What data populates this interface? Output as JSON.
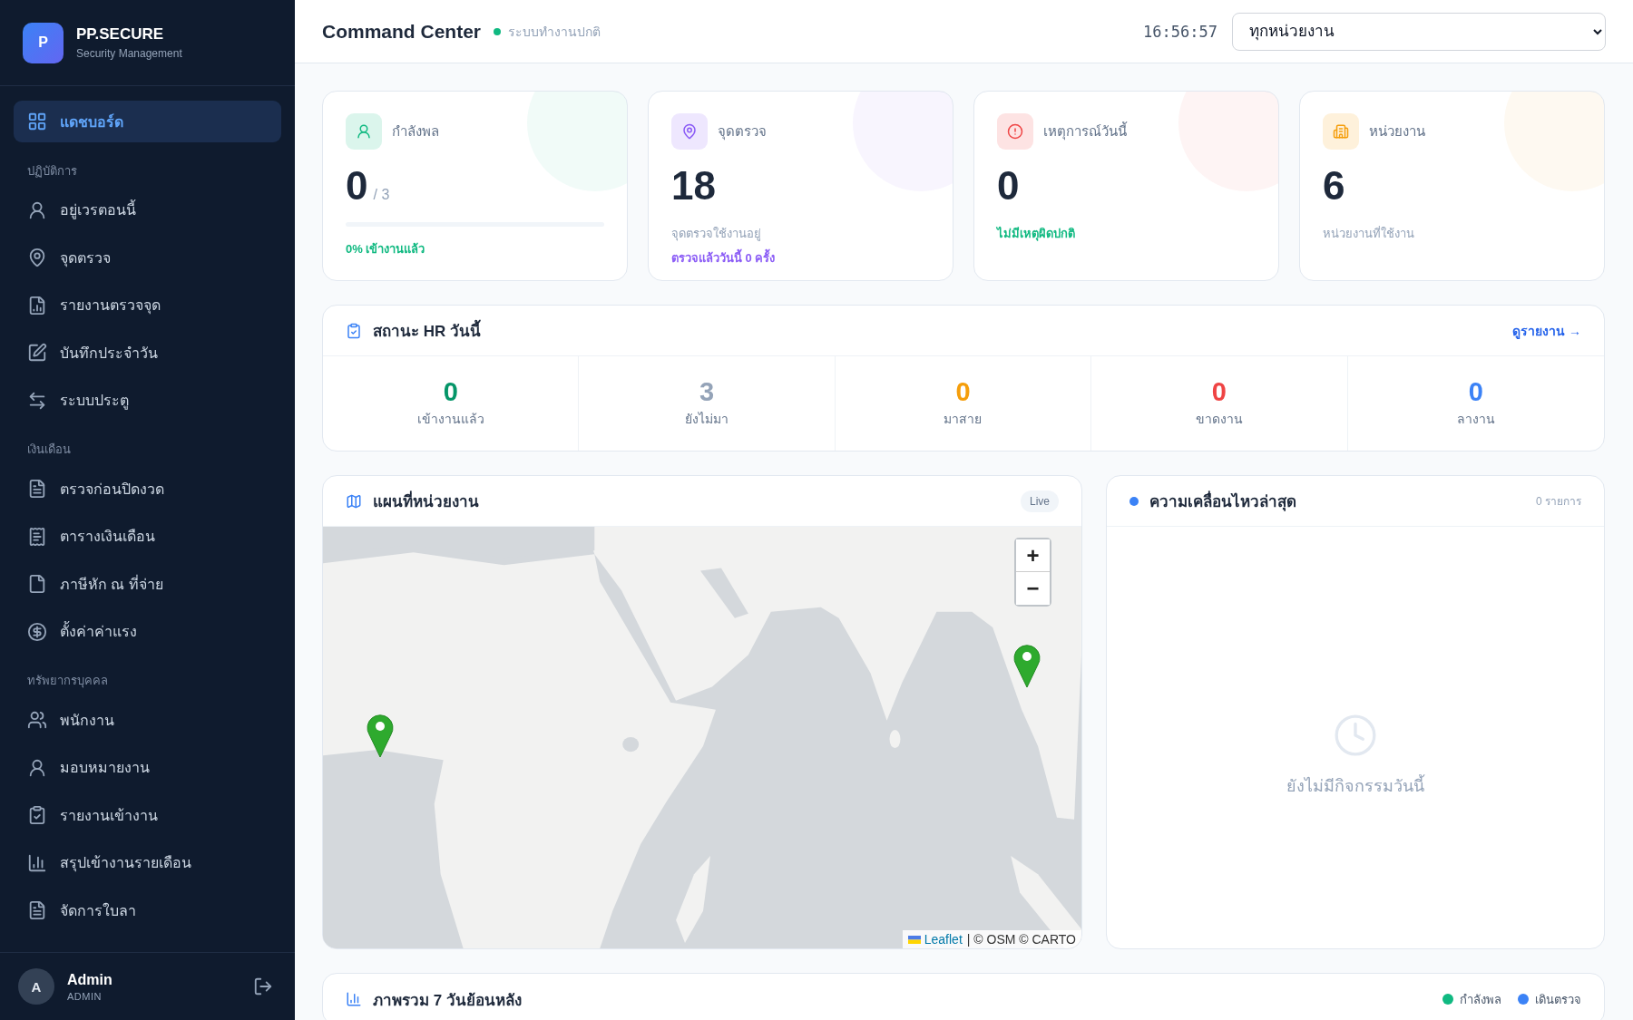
{
  "brand": {
    "logo_letter": "P",
    "name": "PP.SECURE",
    "tagline": "Security Management"
  },
  "sidebar": {
    "items": [
      {
        "label": "แดชบอร์ด",
        "selected": true
      }
    ],
    "sections": [
      {
        "title": "ปฏิบัติการ",
        "items": [
          {
            "label": "อยู่เวรตอนนี้",
            "selected": false
          },
          {
            "label": "จุดตรวจ",
            "selected": false
          },
          {
            "label": "รายงานตรวจจุด",
            "selected": false
          },
          {
            "label": "บันทึกประจำวัน",
            "selected": false
          },
          {
            "label": "ระบบประตู",
            "selected": false
          }
        ]
      },
      {
        "title": "เงินเดือน",
        "items": [
          {
            "label": "ตรวจก่อนปิดงวด",
            "selected": false
          },
          {
            "label": "ตารางเงินเดือน",
            "selected": false
          },
          {
            "label": "ภาษีหัก ณ ที่จ่าย",
            "selected": false
          },
          {
            "label": "ตั้งค่าค่าแรง",
            "selected": false
          }
        ]
      },
      {
        "title": "ทรัพยากรบุคคล",
        "items": [
          {
            "label": "พนักงาน",
            "selected": false
          },
          {
            "label": "มอบหมายงาน",
            "selected": false
          },
          {
            "label": "รายงานเข้างาน",
            "selected": false
          },
          {
            "label": "สรุปเข้างานรายเดือน",
            "selected": false
          },
          {
            "label": "จัดการใบลา",
            "selected": false
          }
        ]
      }
    ],
    "user": {
      "initial": "A",
      "name": "Admin",
      "role": "ADMIN"
    }
  },
  "header": {
    "title": "Command Center",
    "status": "ระบบทำงานปกติ",
    "clock": "16:56:57",
    "unit_select": "ทุกหน่วยงาน"
  },
  "stat_cards": [
    {
      "label": "กำลังพล",
      "value": "0",
      "total": "/ 3",
      "color": "#10b981",
      "level": 0,
      "notes": [
        {
          "text": "0% เข้างานแล้ว",
          "kind": "accent"
        }
      ]
    },
    {
      "label": "จุดตรวจ",
      "value": "18",
      "color": "#8b5cf6",
      "notes": [
        {
          "text": "จุดตรวจใช้งานอยู่",
          "kind": "muted"
        },
        {
          "text": "ตรวจแล้ววันนี้ 0 ครั้ง",
          "kind": "accent"
        }
      ]
    },
    {
      "label": "เหตุการณ์วันนี้",
      "value": "0",
      "color": "#ef4444",
      "notes": [
        {
          "text": "ไม่มีเหตุผิดปกติ",
          "kind": "success"
        }
      ]
    },
    {
      "label": "หน่วยงาน",
      "value": "6",
      "color": "#f59e0b",
      "notes": [
        {
          "text": "หน่วยงานที่ใช้งาน",
          "kind": "muted"
        }
      ]
    }
  ],
  "hr_status": {
    "title": "สถานะ HR วันนี้",
    "link": "ดูรายงาน →",
    "stats": [
      {
        "value": "0",
        "label": "เข้างานแล้ว",
        "color": "#059669"
      },
      {
        "value": "3",
        "label": "ยังไม่มา",
        "color": "#94a3b8"
      },
      {
        "value": "0",
        "label": "มาสาย",
        "color": "#f59e0b"
      },
      {
        "value": "0",
        "label": "ขาดงาน",
        "color": "#ef4444"
      },
      {
        "value": "0",
        "label": "ลางาน",
        "color": "#3b82f6"
      }
    ]
  },
  "map_panel": {
    "title": "แผนที่หน่วยงาน",
    "badge": "Live",
    "zoom_in": "+",
    "zoom_out": "−",
    "attribution_link": "Leaflet",
    "attribution": "| © OSM © CARTO"
  },
  "activity_panel": {
    "title": "ความเคลื่อนไหวล่าสุด",
    "count": "0 รายการ",
    "empty": "ยังไม่มีกิจกรรมวันนี้"
  },
  "overview_panel": {
    "title": "ภาพรวม 7 วันย้อนหลัง",
    "legend": [
      {
        "label": "กำลังพล",
        "color": "#10b981"
      },
      {
        "label": "เดินตรวจ",
        "color": "#3b82f6"
      }
    ]
  }
}
